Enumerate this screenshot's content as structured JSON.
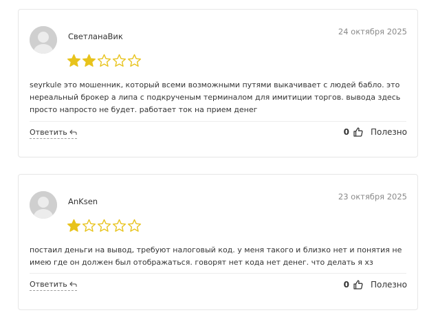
{
  "reviews": [
    {
      "author": "СветланаВик",
      "date": "24 октября 2025",
      "rating": 2,
      "max_rating": 5,
      "text": "seyrkule это мошенник, который всеми возможными путями выкачивает с людей бабло. это нереальный брокер а липа с подкрученым терминалом для имитиции торгов. вывода здесь просто напросто не будет. работает ток на прием денег",
      "reply_label": "Ответить",
      "likes": "0",
      "helpful_label": "Полезно"
    },
    {
      "author": "AnKsen",
      "date": "23 октября 2025",
      "rating": 1,
      "max_rating": 5,
      "text": "постаил деньги на вывод, требуют налоговый код. у меня такого и близко нет и понятия не имею где он должен был отображаться. говорят нет кода нет денег. что делать я хз",
      "reply_label": "Ответить",
      "likes": "0",
      "helpful_label": "Полезно"
    }
  ],
  "colors": {
    "star_filled": "#e8c31c",
    "star_empty_stroke": "#e8c31c",
    "avatar_bg": "#cfcfcf"
  },
  "icons": {
    "avatar": "user-silhouette-icon",
    "reply": "reply-arrow-icon",
    "like": "thumbs-up-icon"
  }
}
